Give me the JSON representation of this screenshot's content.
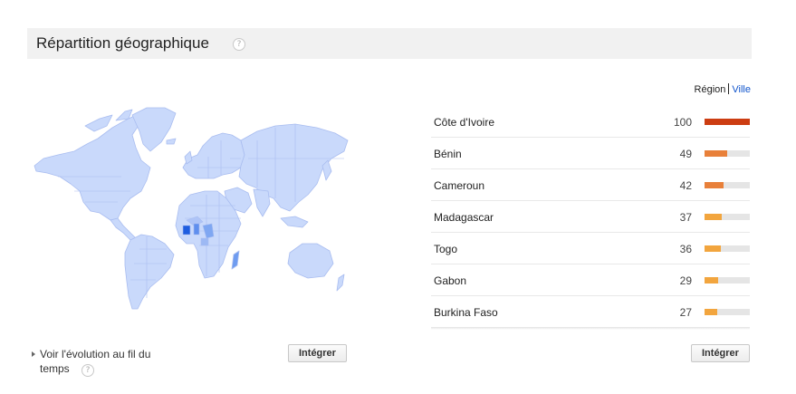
{
  "header": {
    "title": "Répartition géographique",
    "help_glyph": "?"
  },
  "view_toggle": {
    "active": "Région",
    "other": "Ville"
  },
  "map": {
    "base_color": "#c9d9fb",
    "border_color": "#a9bdf0",
    "highlight_color": "#1e5de0"
  },
  "ranking": [
    {
      "name": "Côte d'Ivoire",
      "value": "100",
      "fraction": 1.0,
      "color": "#cc3d12"
    },
    {
      "name": "Bénin",
      "value": "49",
      "fraction": 0.49,
      "color": "#e8803a"
    },
    {
      "name": "Cameroun",
      "value": "42",
      "fraction": 0.42,
      "color": "#e8803a"
    },
    {
      "name": "Madagascar",
      "value": "37",
      "fraction": 0.37,
      "color": "#f2a53e"
    },
    {
      "name": "Togo",
      "value": "36",
      "fraction": 0.36,
      "color": "#f2a53e"
    },
    {
      "name": "Gabon",
      "value": "29",
      "fraction": 0.29,
      "color": "#f2a53e"
    },
    {
      "name": "Burkina Faso",
      "value": "27",
      "fraction": 0.27,
      "color": "#f2a53e"
    }
  ],
  "footer": {
    "evolution_text": "Voir l'évolution au fil du temps",
    "help_glyph": "?",
    "embed_label_left": "Intégrer",
    "embed_label_right": "Intégrer"
  }
}
